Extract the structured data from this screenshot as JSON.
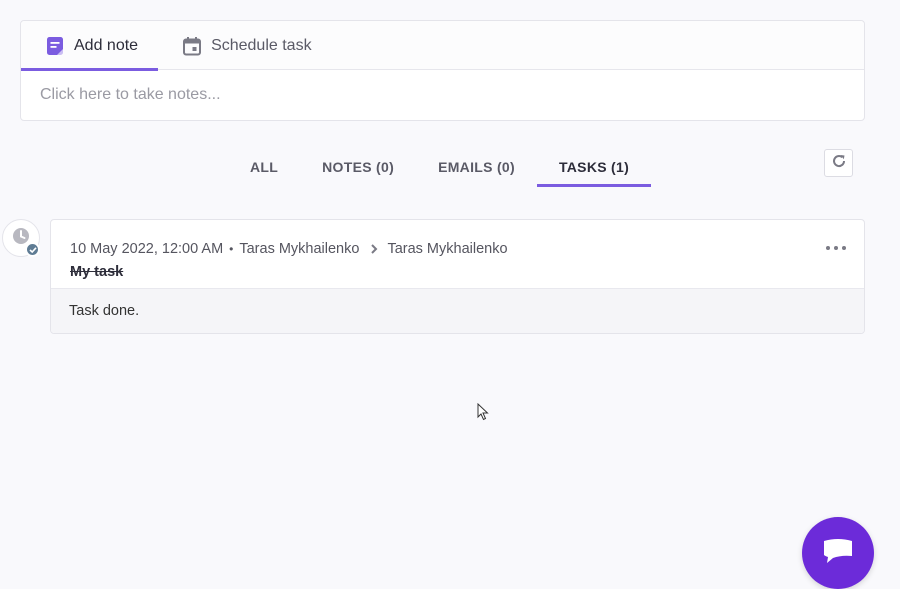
{
  "note_editor": {
    "tabs": [
      {
        "label": "Add note",
        "icon": "note-icon",
        "active": true
      },
      {
        "label": "Schedule task",
        "icon": "calendar-icon",
        "active": false
      }
    ],
    "placeholder": "Click here to take notes..."
  },
  "filters": {
    "tabs": [
      {
        "label": "ALL",
        "active": false
      },
      {
        "label": "NOTES (0)",
        "active": false
      },
      {
        "label": "EMAILS (0)",
        "active": false
      },
      {
        "label": "TASKS (1)",
        "active": true
      }
    ],
    "refresh_icon": "refresh-icon"
  },
  "timeline": {
    "items": [
      {
        "icon": "clock-icon",
        "badge_icon": "check-icon",
        "timestamp": "10 May 2022, 12:00 AM",
        "separator": "•",
        "author": "Taras Mykhailenko",
        "assignee": "Taras Mykhailenko",
        "title": "My task",
        "body": "Task done."
      }
    ]
  },
  "colors": {
    "accent": "#7b5ce0",
    "chat": "#6c2bd9",
    "badge": "#5f7c94"
  },
  "chat": {
    "icon": "chat-bubble-icon"
  }
}
